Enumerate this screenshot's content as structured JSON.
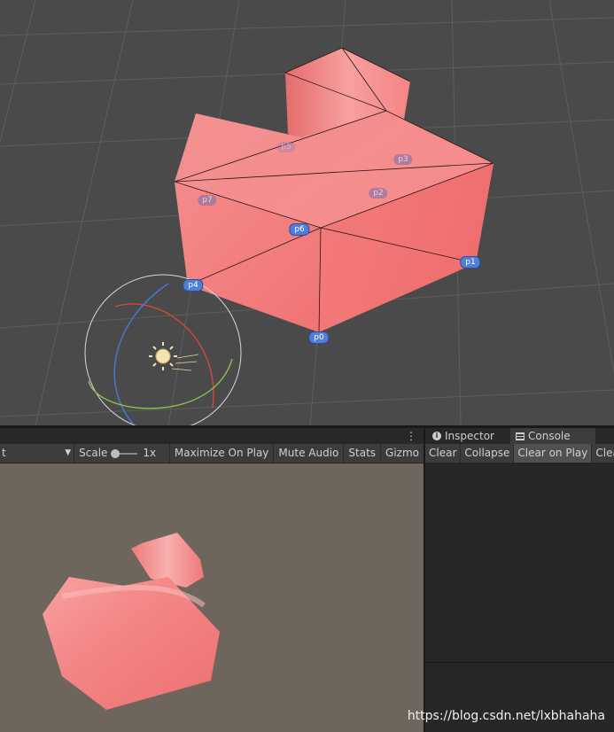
{
  "scene": {
    "vertex_labels_front": [
      "p0",
      "p1",
      "p4",
      "p6"
    ],
    "vertex_labels_back": [
      "p2",
      "p3",
      "p5",
      "p7"
    ]
  },
  "game_view": {
    "resolution_value": "t",
    "scale_label": "Scale",
    "scale_value": "1x",
    "maximize_on_play": "Maximize On Play",
    "mute_audio": "Mute Audio",
    "stats": "Stats",
    "gizmos": "Gizmo",
    "menu_glyph": "⋮"
  },
  "right_panel": {
    "tabs": [
      "Inspector",
      "Console"
    ],
    "console_buttons": [
      "Clear",
      "Collapse",
      "Clear on Play",
      "Clea"
    ]
  },
  "colors": {
    "mesh": "#f47c7c",
    "scene_bg": "#4a4a4a",
    "game_bg": "#6e655d",
    "vertex_front": "#4f7fd6"
  },
  "watermark": "https://blog.csdn.net/lxbhahaha"
}
